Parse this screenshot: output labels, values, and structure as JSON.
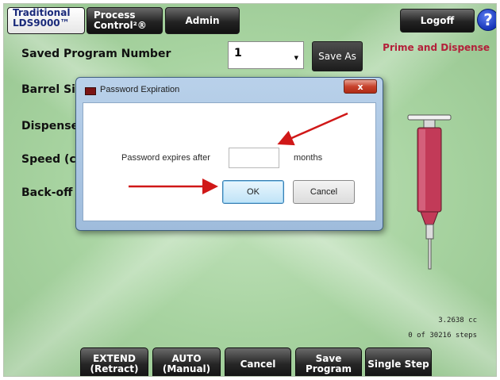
{
  "tabs": {
    "traditional_line1": "Traditional",
    "traditional_line2": "LDS9000™",
    "process_line1": "Process",
    "process_line2": "Control²®",
    "admin": "Admin"
  },
  "header": {
    "logoff": "Logoff",
    "help": "?",
    "mode_title": "Prime and Dispense"
  },
  "form": {
    "saved_program_label": "Saved Program Number",
    "saved_program_value": "1",
    "save_as": "Save As",
    "barrel_size_label": "Barrel Siz",
    "dispense_label": "Dispense",
    "speed_label": "Speed (cc",
    "backoff_label": "Back-off ("
  },
  "status": {
    "volume": "3.2638 cc",
    "steps": "0 of 30216 steps"
  },
  "bottom_buttons": {
    "extend_line1": "EXTEND",
    "extend_line2": "(Retract)",
    "auto_line1": "AUTO",
    "auto_line2": "(Manual)",
    "cancel": "Cancel",
    "save_line1": "Save",
    "save_line2": "Program",
    "single_step": "Single Step"
  },
  "dialog": {
    "title": "Password Expiration",
    "close": "x",
    "prompt": "Password expires after",
    "value": "",
    "unit": "months",
    "ok": "OK",
    "cancel": "Cancel"
  },
  "colors": {
    "background": "#a7d3a0",
    "accent_red": "#b3203a",
    "arrow_red": "#d01818"
  },
  "icons": [
    "help-icon",
    "dialog-app-icon",
    "close-icon",
    "dropdown-caret-icon",
    "syringe-graphic"
  ]
}
